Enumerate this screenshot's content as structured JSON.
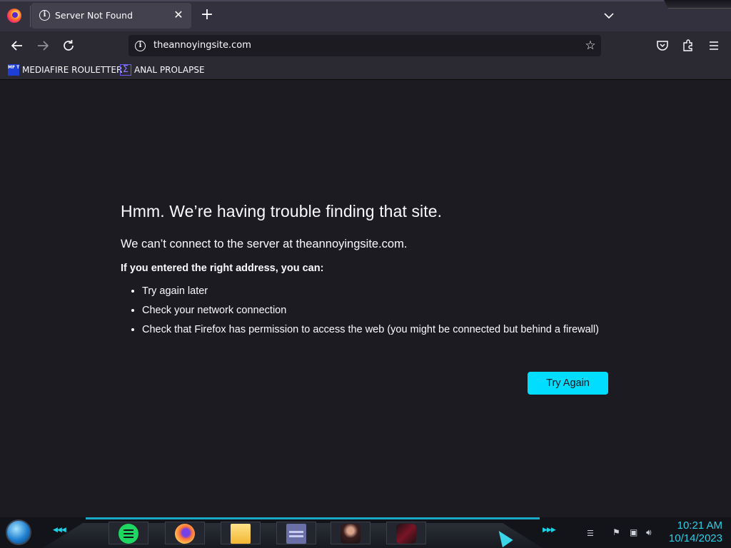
{
  "browser": {
    "tab": {
      "title": "Server Not Found",
      "close_glyph": "✕"
    },
    "new_tab_glyph": "+",
    "url": "theannoyingsite.com",
    "star_glyph": "☆"
  },
  "bookmarks": [
    {
      "label": "MEDIAFIRE ROULETTER",
      "icon_text": "MF T",
      "icon": "mediafire-icon"
    },
    {
      "label": "ANAL PROLAPSE",
      "icon_text": "Σ",
      "icon": "sigma-icon"
    }
  ],
  "error_page": {
    "title": "Hmm. We’re having trouble finding that site.",
    "short_desc": "We can’t connect to the server at theannoyingsite.com.",
    "hint": "If you entered the right address, you can:",
    "suggestions": [
      "Try again later",
      "Check your network connection",
      "Check that Firefox has permission to access the web (you might be connected but behind a firewall)"
    ],
    "button": "Try Again"
  },
  "taskbar": {
    "apps": [
      "notes-app-icon",
      "firefox-icon",
      "file-explorer-icon",
      "id-card-app-icon",
      "portrait-app-icon",
      "red-app-icon"
    ],
    "chevrons": "◀◀◀",
    "chevrons_right": "▶▶▶",
    "clock": {
      "time": "10:21 AM",
      "date": "10/14/2023"
    }
  },
  "colors": {
    "accent": "#00ddff",
    "page_bg": "#1c1b22",
    "toolbar_bg": "#2b2a33",
    "taskbar_accent": "#28d0e8"
  }
}
